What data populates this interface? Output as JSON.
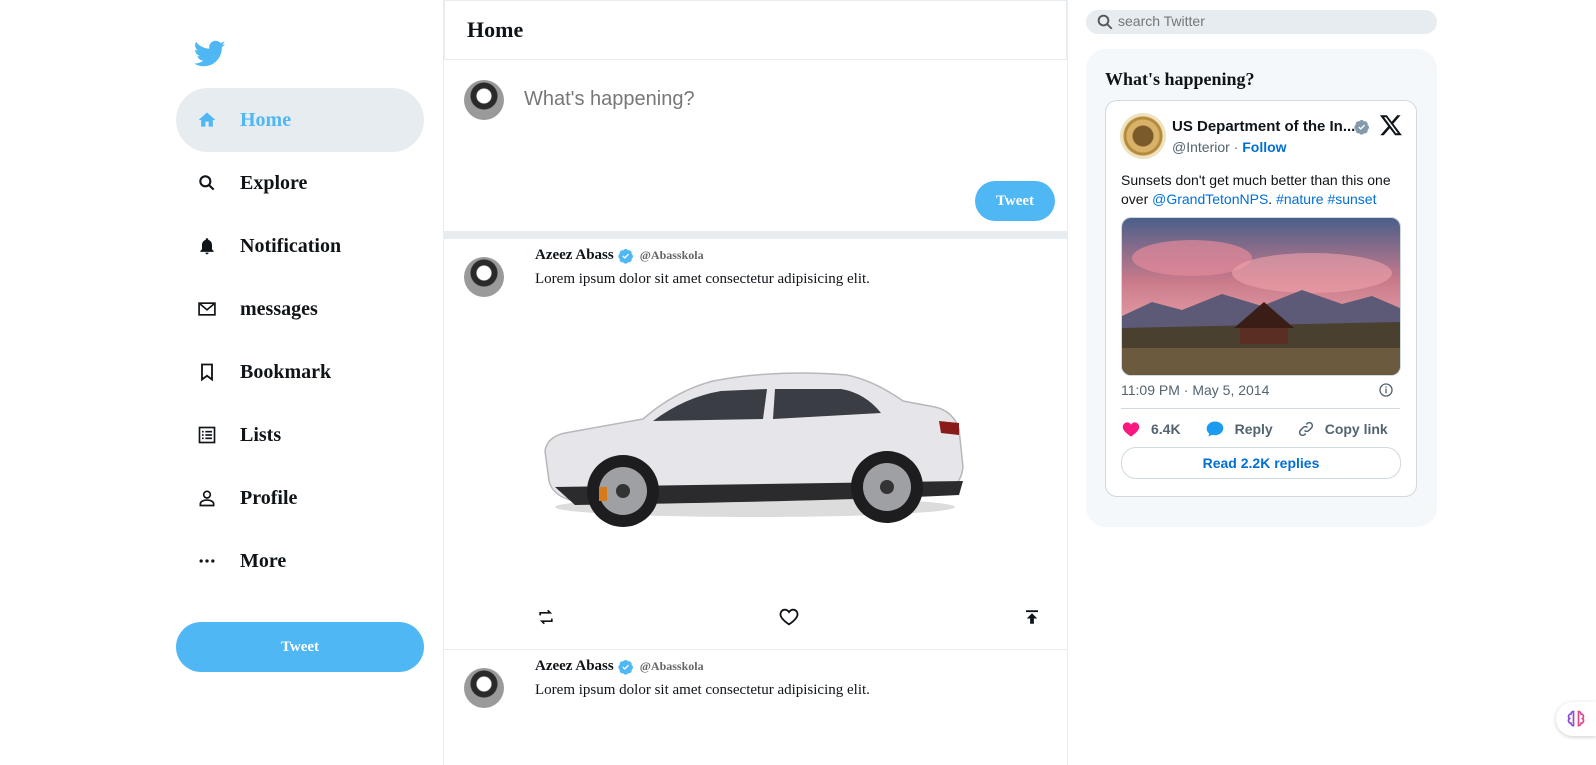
{
  "sidebar": {
    "logo": "twitter-bird-icon",
    "items": [
      {
        "label": "Home",
        "icon": "home-icon",
        "active": true
      },
      {
        "label": "Explore",
        "icon": "search-icon"
      },
      {
        "label": "Notification",
        "icon": "bell-icon"
      },
      {
        "label": "messages",
        "icon": "mail-icon"
      },
      {
        "label": "Bookmark",
        "icon": "bookmark-icon"
      },
      {
        "label": "Lists",
        "icon": "list-icon"
      },
      {
        "label": "Profile",
        "icon": "person-icon"
      },
      {
        "label": "More",
        "icon": "more-icon"
      }
    ],
    "tweet_button": "Tweet"
  },
  "feed": {
    "title": "Home",
    "composer": {
      "placeholder": "What's happening?",
      "tweet_button": "Tweet"
    },
    "posts": [
      {
        "name": "Azeez Abass",
        "handle": "@Abasskola",
        "text": "Lorem ipsum dolor sit amet consectetur adipisicing elit.",
        "image": "white-car"
      },
      {
        "name": "Azeez Abass",
        "handle": "@Abasskola",
        "text": "Lorem ipsum dolor sit amet consectetur adipisicing elit."
      }
    ]
  },
  "right": {
    "search_placeholder": "search Twitter",
    "widget_title": "What's happening?",
    "embed": {
      "name": "US Department of the In...",
      "handle": "@Interior",
      "separator": "·",
      "follow": "Follow",
      "text_plain": "Sunsets don't get much better than this one over ",
      "mention": "@GrandTetonNPS",
      "text_dot": ".",
      "hashtag1": "#nature",
      "hashtag2": "#sunset",
      "time": "11:09 PM · May 5, 2014",
      "likes": "6.4K",
      "reply": "Reply",
      "copy_link": "Copy link",
      "read_replies": "Read 2.2K replies"
    }
  },
  "colors": {
    "accent": "#50b7f5",
    "hover_bg": "#e6ecf0",
    "link": "#006fd6",
    "like": "#f91880"
  }
}
